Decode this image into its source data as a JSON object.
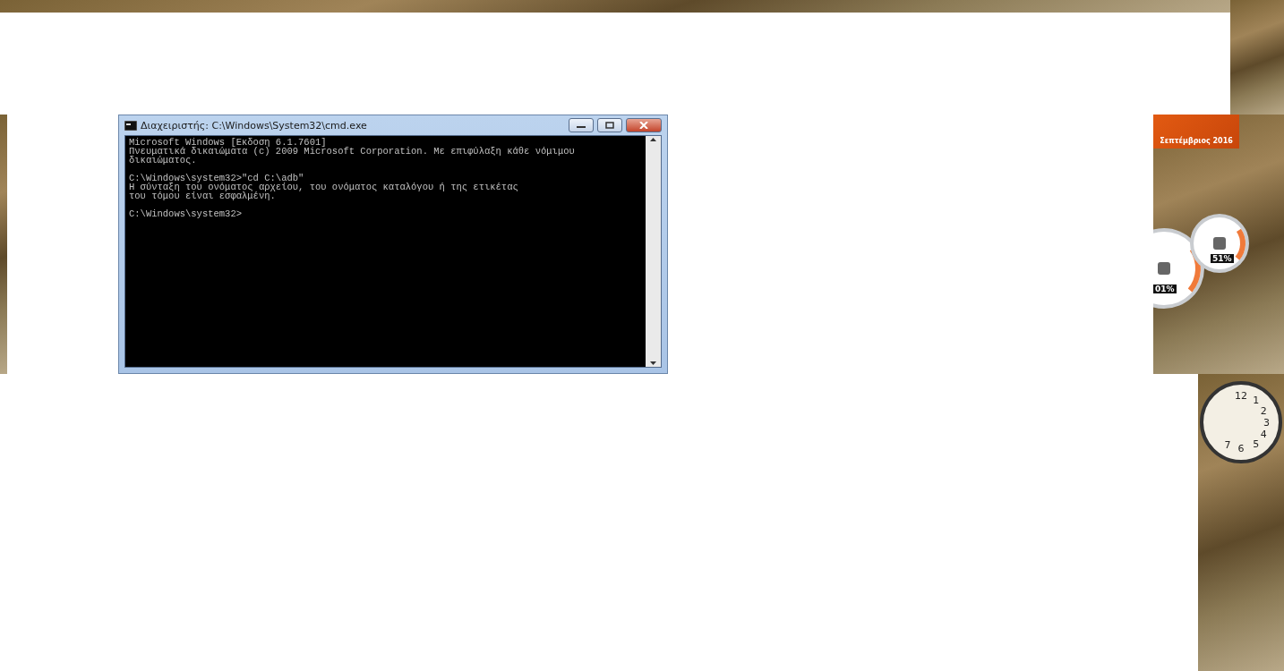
{
  "window": {
    "title": "Διαχειριστής: C:\\Windows\\System32\\cmd.exe"
  },
  "console": {
    "blocks": [
      [
        "Microsoft Windows [Εκδοση 6.1.7601]",
        "Πνευματικά δικαιώματα (c) 2009 Microsoft Corporation. Με επιφύλαξη κάθε νόμιμου",
        "δικαιώματος."
      ],
      [
        "C:\\Windows\\system32>\"cd C:\\adb\"",
        "Η σύνταξη του ονόματος αρχείου, του ονόματος καταλόγου ή της ετικέτας",
        "του τόμου είναι εσφαλμένη."
      ],
      [
        "C:\\Windows\\system32>"
      ]
    ]
  },
  "gadgets": {
    "calendar": {
      "month": "Σεπτέμβριος 2016"
    },
    "meters": [
      {
        "reading": "01%"
      },
      {
        "reading": "51%"
      }
    ],
    "clock": {
      "numerals": [
        "12",
        "1",
        "2",
        "3",
        "4",
        "5",
        "6",
        "7"
      ]
    }
  }
}
